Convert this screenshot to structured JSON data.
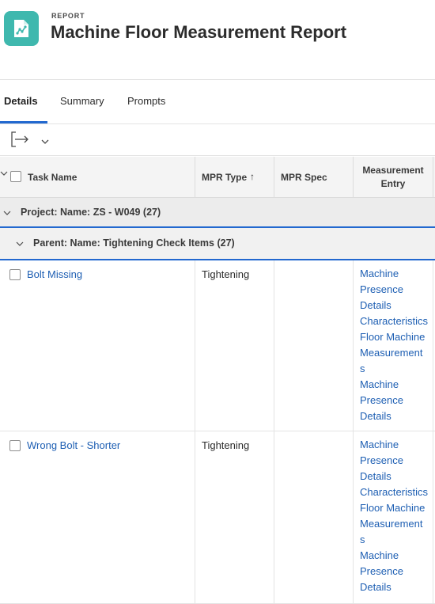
{
  "header": {
    "eyebrow": "REPORT",
    "title": "Machine Floor Measurement Report",
    "icon": "report-chart-icon",
    "accent_color": "#3fb8ae"
  },
  "tabs": [
    {
      "label": "Details",
      "active": true
    },
    {
      "label": "Summary",
      "active": false
    },
    {
      "label": "Prompts",
      "active": false
    }
  ],
  "toolbar": {
    "export_icon": "export-icon",
    "menu_icon": "chevron-down-icon"
  },
  "columns": {
    "task_name": "Task Name",
    "mpr_type": "MPR Type",
    "sort_indicator": "↑",
    "mpr_spec": "MPR Spec",
    "measurement_entry_line1": "Measurement",
    "measurement_entry_line2": "Entry"
  },
  "groups": {
    "project": "Project: Name: ZS - W049 (27)",
    "parent": "Parent: Name: Tightening Check Items (27)"
  },
  "rows": [
    {
      "task_name": "Bolt Missing",
      "mpr_type": "Tightening",
      "mpr_spec": "",
      "entries": [
        "Machine",
        "Presence",
        "Details",
        "Characteristics",
        "Floor Machine",
        "Measurement",
        "s",
        "Machine",
        "Presence",
        "Details"
      ]
    },
    {
      "task_name": "Wrong Bolt - Shorter",
      "mpr_type": "Tightening",
      "mpr_spec": "",
      "entries": [
        "Machine",
        "Presence",
        "Details",
        "Characteristics",
        "Floor Machine",
        "Measurement",
        "s",
        "Machine",
        "Presence",
        "Details"
      ]
    }
  ],
  "colors": {
    "link": "#1e5fb3",
    "tab_active_underline": "#2268cf",
    "group_border": "#2268cf"
  }
}
